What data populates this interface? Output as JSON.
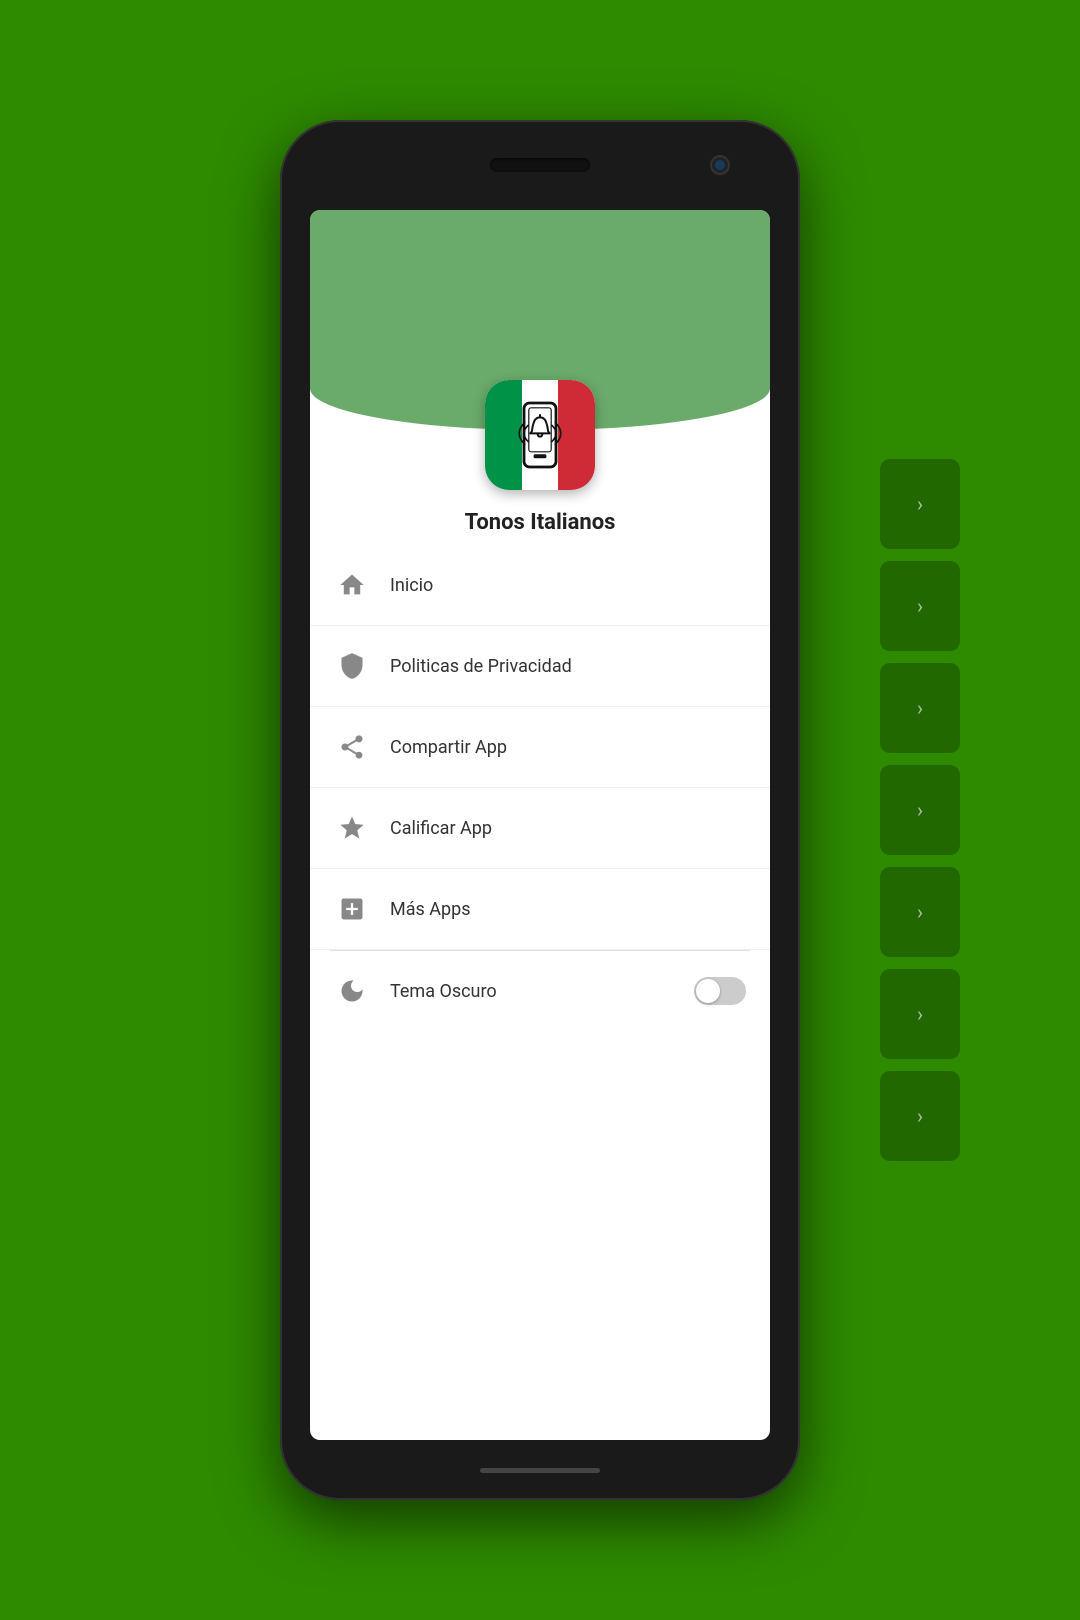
{
  "background_color": "#2e8b00",
  "app": {
    "title": "Tonos Italianos",
    "icon_alt": "Tonos Italianos app icon"
  },
  "menu": {
    "items": [
      {
        "id": "inicio",
        "label": "Inicio",
        "icon": "home"
      },
      {
        "id": "privacidad",
        "label": "Politicas de Privacidad",
        "icon": "shield"
      },
      {
        "id": "compartir",
        "label": "Compartir App",
        "icon": "share"
      },
      {
        "id": "calificar",
        "label": "Calificar App",
        "icon": "star"
      },
      {
        "id": "mas-apps",
        "label": "Más Apps",
        "icon": "plus-square"
      }
    ],
    "settings": [
      {
        "id": "tema-oscuro",
        "label": "Tema Oscuro",
        "icon": "moon",
        "toggle": true,
        "toggle_value": false
      }
    ]
  },
  "side_panels": [
    {
      "id": "panel-1"
    },
    {
      "id": "panel-2"
    },
    {
      "id": "panel-3"
    },
    {
      "id": "panel-4"
    },
    {
      "id": "panel-5"
    },
    {
      "id": "panel-6"
    },
    {
      "id": "panel-7"
    }
  ]
}
